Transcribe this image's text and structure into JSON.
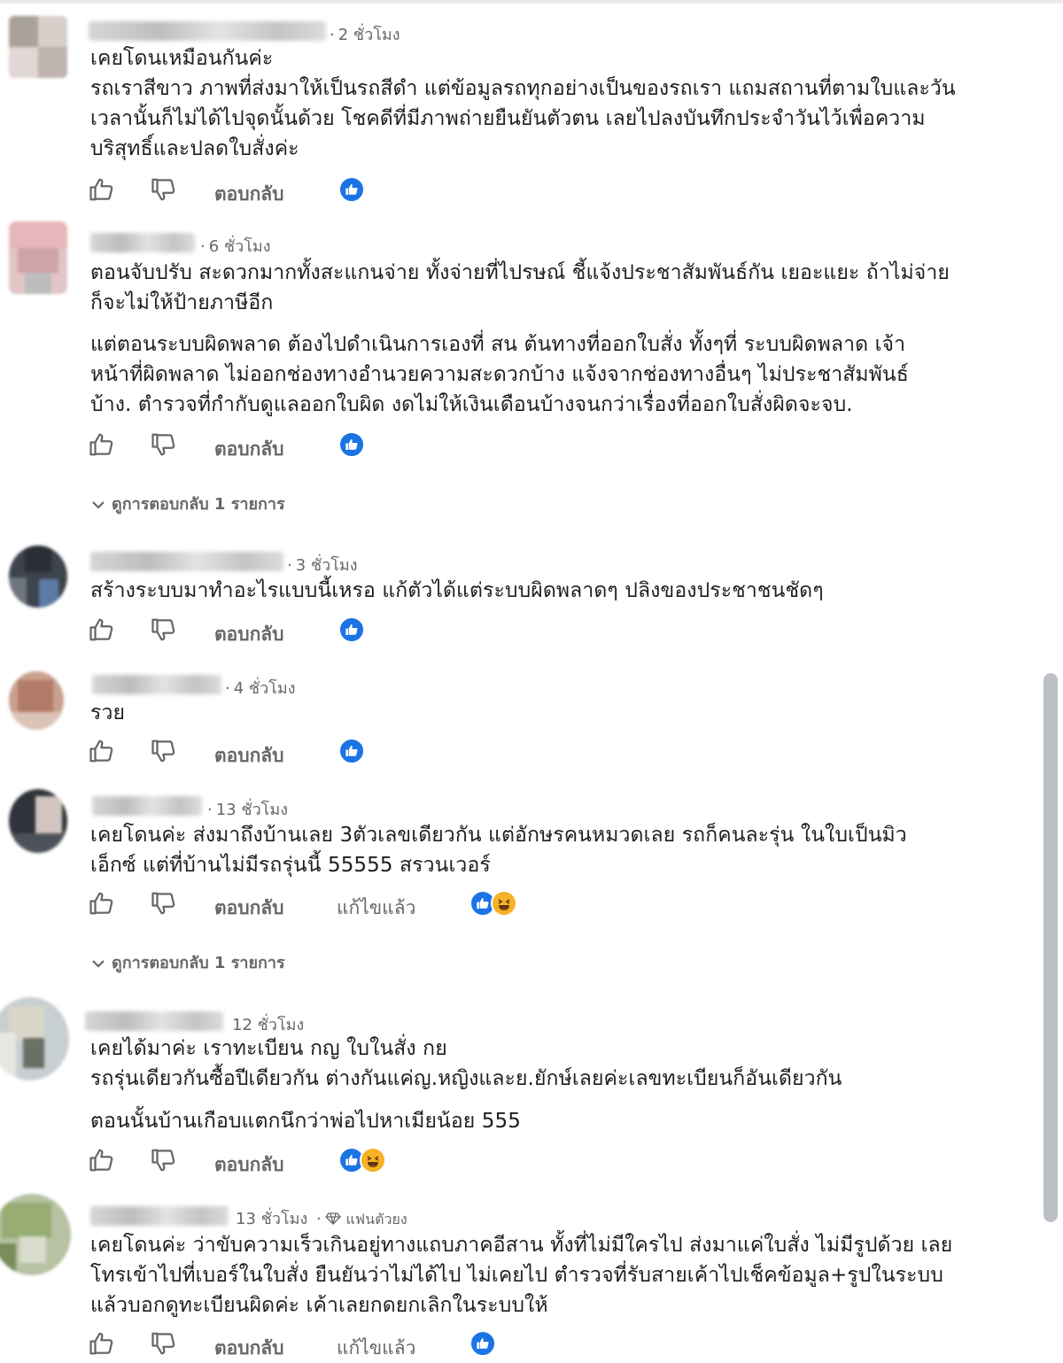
{
  "ui": {
    "reply_label": "ตอบกลับ",
    "edited_label": "แก้ไขแล้ว",
    "like_icon": "thumbs-up-outline-icon",
    "dislike_icon": "thumbs-down-outline-icon",
    "reaction_like_color": "#1b74e4",
    "reaction_haha_color": "#f7b125",
    "meta_color": "#65676b"
  },
  "comments": [
    {
      "time": "2 ชั่วโมง",
      "text": "เคยโดนเหมือนกันค่ะ\nรถเราสีขาว ภาพที่ส่งมาให้เป็นรถสีดำ แต่ข้อมูลรถทุกอย่างเป็นของรถเรา แถมสถานที่ตามใบและวัน\nเวลานั้นก็ไม่ได้ไปจุดนั้นด้วย โชคดีที่มีภาพถ่ายยืนยันตัวตน เลยไปลงบันทึกประจำวันไว้เพื่อความ\nบริสุทธิ์และปลดใบสั่งค่ะ"
    },
    {
      "time": "6 ชั่วโมง",
      "text": "ตอนจับปรับ สะดวกมากทั้งสะแกนจ่าย ทั้งจ่ายที่ไปรษณ์ ชี้แจ้งประชาสัมพันธ์กัน เยอะแยะ ถ้าไม่จ่าย\nก็จะไม่ให้ป้ายภาษีอีก",
      "text2": "แต่ตอนระบบผิดพลาด ต้องไปดำเนินการเองที่ สน ต้นทางที่ออกใบสั่ง ทั้งๆที่ ระบบผิดพลาด เจ้า\nหน้าที่ผิดพลาด ไม่ออกช่องทางอำนวยความสะดวกบ้าง แจ้งจากช่องทางอื่นๆ ไม่ประชาสัมพันธ์\nบ้าง. ตำรวจที่กำกับดูแลออกใบผิด งดไม่ให้เงินเดือนบ้างจนกว่าเรื่องที่ออกใบสั่งผิดจะจบ.",
      "view_replies": "ดูการตอบกลับ 1 รายการ"
    },
    {
      "time": "3 ชั่วโมง",
      "text": "สร้างระบบมาทำอะไรแบบนี้เหรอ แก้ตัวได้แต่ระบบผิดพลาดๆ ปลิงของประชาชนชัดๆ"
    },
    {
      "time": "4 ชั่วโมง",
      "text": "รวย"
    },
    {
      "time": "13 ชั่วโมง",
      "text": "เคยโดนค่ะ ส่งมาถึงบ้านเลย 3ตัวเลขเดียวกัน แต่อักษรคนหมวดเลย รถก็คนละรุ่น ในใบเป็นมิว\nเอ็กซ์ แต่ที่บ้านไม่มีรถรุ่นนี้ 55555 สรวนเวอร์",
      "edited": true,
      "view_replies": "ดูการตอบกลับ 1 รายการ"
    },
    {
      "time": "12 ชั่วโมง",
      "text": "เคยได้มาค่ะ เราทะเบียน กญ ใบในสั่ง กย\nรถรุ่นเดียวกันซื้อปีเดียวกัน ต่างกันแค่ญ.หญิงและย.ยักษ์เลยค่ะเลขทะเบียนก็อันเดียวกัน",
      "text2": "ตอนนั้นบ้านเกือบแตกนึกว่าพ่อไปหาเมียน้อย 555"
    },
    {
      "time": "13 ชั่วโมง",
      "badge": "แฟนตัวยง",
      "badge_icon": "diamond-icon",
      "text": "เคยโดนค่ะ ว่าขับความเร็วเกินอยู่ทางแถบภาคอีสาน ทั้งที่ไม่มีใครไป ส่งมาแค่ใบสั่ง ไม่มีรูปด้วย เลย\nโทรเข้าไปที่เบอร์ในใบสั่ง ยืนยันว่าไม่ได้ไป ไม่เคยไป ตำรวจที่รับสายเค้าไปเช็คข้อมูล+รูปในระบบ\nแล้วบอกดูทะเบียนผิดค่ะ เค้าเลยกดยกเลิกในระบบให้",
      "edited": true
    }
  ]
}
